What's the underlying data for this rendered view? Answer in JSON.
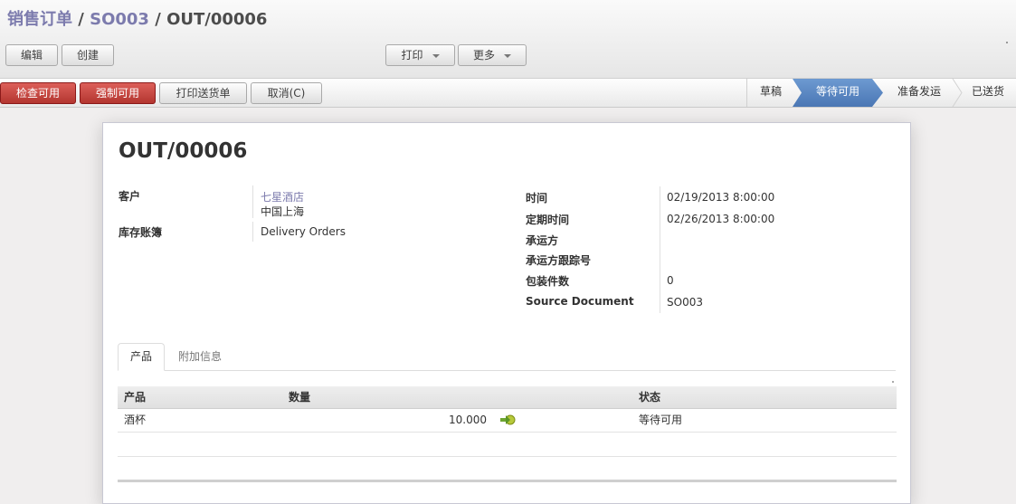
{
  "breadcrumb": {
    "root": "销售订单",
    "parent": "SO003",
    "current": "OUT/00006",
    "sep": " / "
  },
  "toolbar": {
    "edit": "编辑",
    "create": "创建",
    "print": "打印",
    "more": "更多"
  },
  "actions": {
    "check_availability": "检查可用",
    "force_availability": "强制可用",
    "print_delivery": "打印送货单",
    "cancel": "取消(C)"
  },
  "stages": [
    {
      "label": "草稿",
      "active": false
    },
    {
      "label": "等待可用",
      "active": true
    },
    {
      "label": "准备发运",
      "active": false
    },
    {
      "label": "已送货",
      "active": false
    }
  ],
  "form": {
    "title": "OUT/00006",
    "customer_label": "客户",
    "customer_name": "七星酒店",
    "customer_address": "中国上海",
    "journal_label": "库存账簿",
    "journal_value": "Delivery Orders",
    "date_label": "时间",
    "date_value": "02/19/2013 8:00:00",
    "scheduled_label": "定期时间",
    "scheduled_value": "02/26/2013 8:00:00",
    "carrier_label": "承运方",
    "carrier_value": "",
    "tracking_label": "承运方跟踪号",
    "tracking_value": "",
    "packages_label": "包装件数",
    "packages_value": "0",
    "source_label": "Source Document",
    "source_value": "SO003"
  },
  "tabs": {
    "products": "产品",
    "extra": "附加信息"
  },
  "table": {
    "headers": {
      "product": "产品",
      "qty": "数量",
      "state": "状态"
    },
    "rows": [
      {
        "product": "酒杯",
        "qty": "10.000",
        "state": "等待可用"
      }
    ]
  },
  "colors": {
    "accent": "#7c7bad",
    "danger": "#c0392b",
    "stage_active": "#5b86c2"
  }
}
